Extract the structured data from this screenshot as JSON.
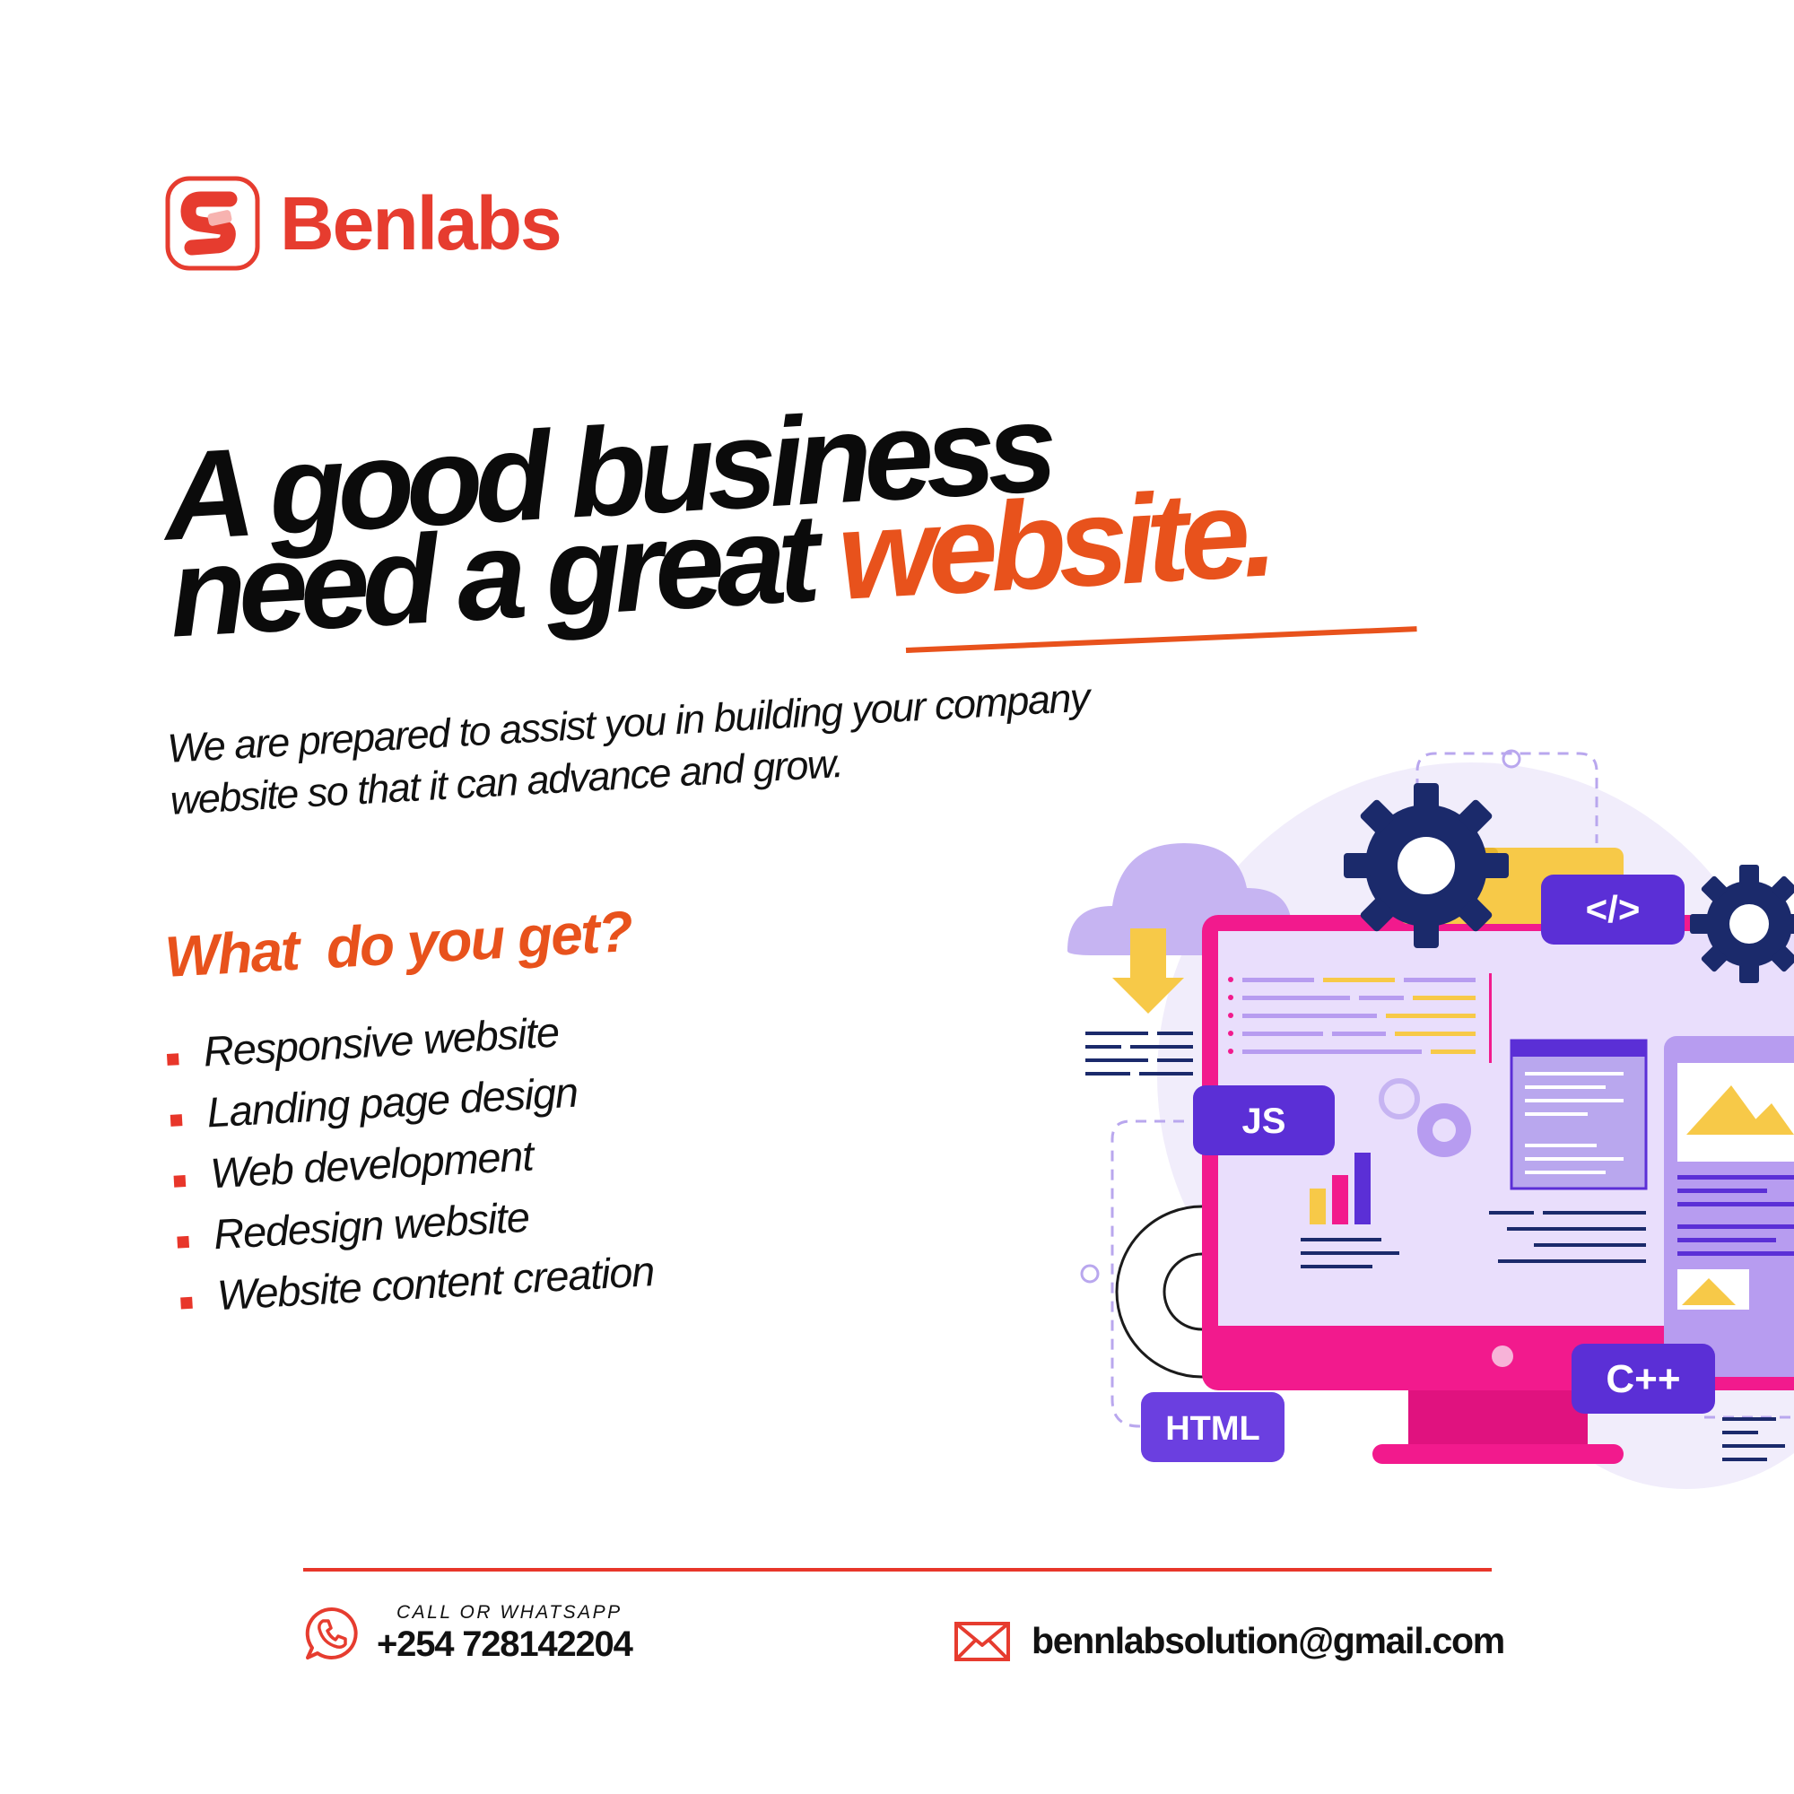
{
  "brand": {
    "name": "Benlabs",
    "color": "#e63c2f"
  },
  "headline": {
    "line1": "A good business",
    "line2_plain": "need a great",
    "line2_accent": "website.",
    "accent_color": "#e8521c"
  },
  "subtext": {
    "line1": "We are prepared to assist you in building your company",
    "line2": "website so that it can advance and grow."
  },
  "offer": {
    "title": "What  do you get?",
    "items": [
      "Responsive website",
      "Landing page design",
      "Web development",
      "Redesign website",
      "Website content creation"
    ]
  },
  "illustration": {
    "tags": {
      "code": "</>",
      "js": "JS",
      "cpp": "C++",
      "html": "HTML"
    },
    "colors": {
      "monitor": "#f21a8d",
      "tag": "#5b2fd6",
      "gear": "#1b2a6b",
      "yellow": "#f7c948",
      "screen": "#e9defc"
    }
  },
  "contact": {
    "phone_caption": "CALL OR WHATSAPP",
    "phone": "+254 728142204",
    "email": "bennlabsolution@gmail.com",
    "icon_phone": "whatsapp-phone-icon",
    "icon_email": "envelope-icon"
  }
}
